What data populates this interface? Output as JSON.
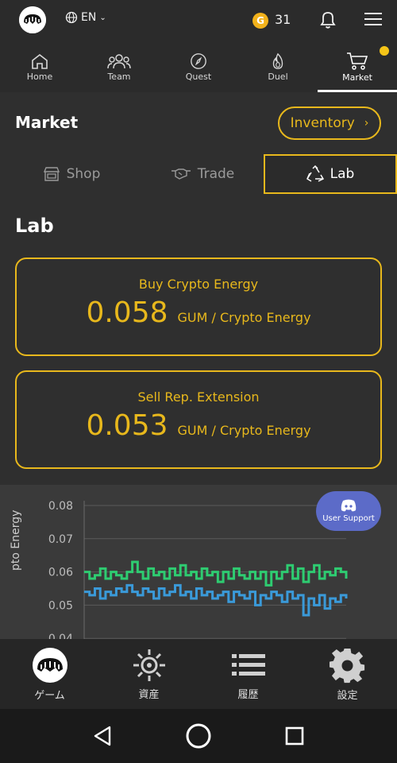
{
  "header": {
    "language": "EN",
    "coin_symbol": "G",
    "coin_count": "31"
  },
  "nav": [
    {
      "label": "Home",
      "icon": "home-icon"
    },
    {
      "label": "Team",
      "icon": "team-icon"
    },
    {
      "label": "Quest",
      "icon": "compass-icon"
    },
    {
      "label": "Duel",
      "icon": "flame-icon"
    },
    {
      "label": "Market",
      "icon": "cart-icon",
      "active": true
    }
  ],
  "market": {
    "title": "Market",
    "inventory_label": "Inventory",
    "tabs": [
      {
        "label": "Shop",
        "icon": "shop-icon"
      },
      {
        "label": "Trade",
        "icon": "handshake-icon"
      },
      {
        "label": "Lab",
        "icon": "recycle-icon",
        "active": true
      }
    ]
  },
  "lab": {
    "title": "Lab",
    "buy": {
      "label": "Buy Crypto Energy",
      "value": "0.058",
      "unit": "GUM / Crypto Energy"
    },
    "sell": {
      "label": "Sell Rep. Extension",
      "value": "0.053",
      "unit": "GUM / Crypto Energy"
    }
  },
  "chart_data": {
    "type": "line",
    "ylabel": "pto Energy",
    "ylim": [
      0.04,
      0.085
    ],
    "yticks": [
      "0.08",
      "0.07",
      "0.06",
      "0.05",
      "0.04"
    ],
    "series": [
      {
        "color": "#2ecc71",
        "values": [
          0.06,
          0.058,
          0.059,
          0.061,
          0.058,
          0.06,
          0.059,
          0.058,
          0.06,
          0.063,
          0.06,
          0.058,
          0.061,
          0.059,
          0.06,
          0.058,
          0.061,
          0.059,
          0.062,
          0.059,
          0.06,
          0.058,
          0.061,
          0.059,
          0.06,
          0.057,
          0.06,
          0.058,
          0.061,
          0.059,
          0.058,
          0.06,
          0.058,
          0.06,
          0.056,
          0.06,
          0.058,
          0.06,
          0.062,
          0.058,
          0.061,
          0.057,
          0.06,
          0.062,
          0.058,
          0.06,
          0.059,
          0.061,
          0.06,
          0.058
        ]
      },
      {
        "color": "#3a9ad9",
        "values": [
          0.054,
          0.053,
          0.055,
          0.052,
          0.054,
          0.053,
          0.055,
          0.054,
          0.056,
          0.054,
          0.053,
          0.055,
          0.054,
          0.052,
          0.055,
          0.053,
          0.054,
          0.056,
          0.053,
          0.054,
          0.052,
          0.055,
          0.053,
          0.054,
          0.052,
          0.053,
          0.054,
          0.051,
          0.054,
          0.053,
          0.052,
          0.054,
          0.05,
          0.053,
          0.052,
          0.054,
          0.053,
          0.051,
          0.054,
          0.052,
          0.053,
          0.047,
          0.052,
          0.05,
          0.053,
          0.049,
          0.052,
          0.051,
          0.053,
          0.052
        ]
      }
    ]
  },
  "support": {
    "label": "User Support"
  },
  "bottom_nav": [
    {
      "label": "ゲーム",
      "icon": "game-icon"
    },
    {
      "label": "資産",
      "icon": "assets-icon"
    },
    {
      "label": "履歴",
      "icon": "history-icon"
    },
    {
      "label": "設定",
      "icon": "settings-icon"
    }
  ]
}
